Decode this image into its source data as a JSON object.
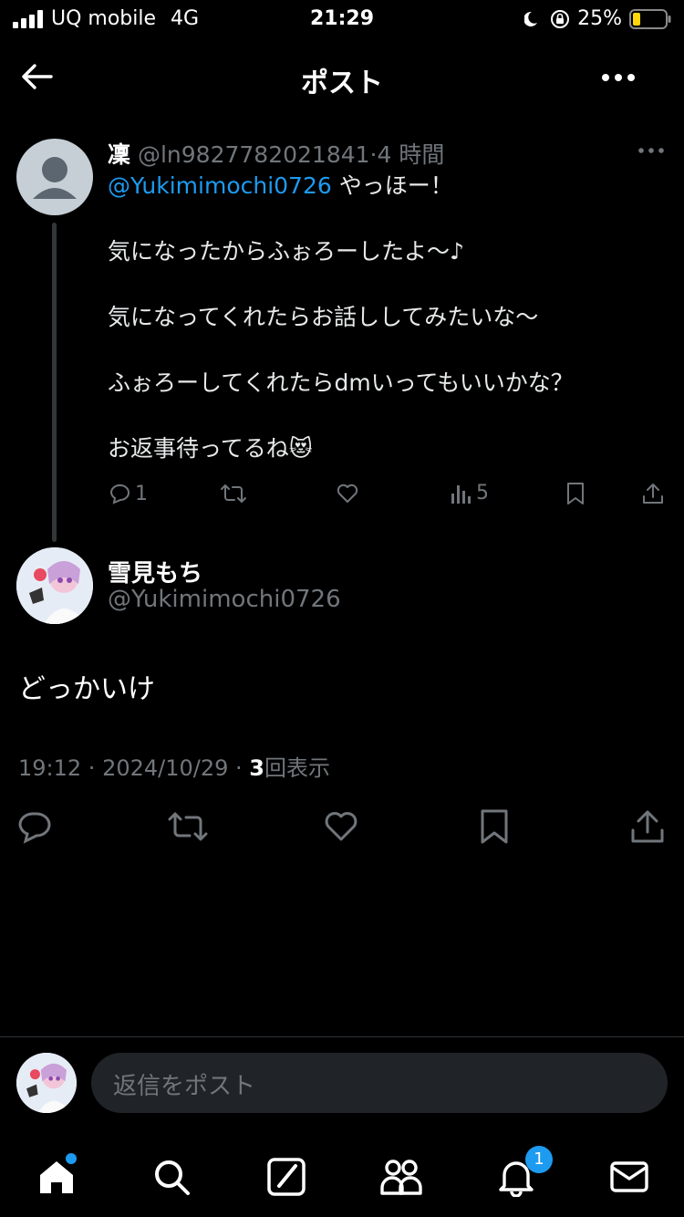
{
  "status_bar": {
    "carrier": "UQ mobile",
    "network": "4G",
    "time": "21:29",
    "battery": "25%"
  },
  "header": {
    "title": "ポスト"
  },
  "tweet1": {
    "name": "凜",
    "handle": "@ln9827782021841",
    "time": "4 時間",
    "mention": "@Yukimimochi0726",
    "lines": [
      "やっほー！",
      "気になったからふぉろーしたよ〜♪",
      "気になってくれたらお話ししてみたいな〜",
      "ふぉろーしてくれたらdmいってもいいかな？",
      "お返事待ってるね😻"
    ],
    "reply_count": "1",
    "view_count": "5"
  },
  "tweet2": {
    "name": "雪見もち",
    "handle": "@Yukimimochi0726",
    "body": "どっかいけ",
    "time": "19:12",
    "date": "2024/10/29",
    "views": "3",
    "views_suffix": "回表示"
  },
  "reply": {
    "placeholder": "返信をポスト"
  },
  "tabbar": {
    "notifications_badge": "1"
  },
  "colors": {
    "accent": "#1d9bf0",
    "muted": "#71767b",
    "background": "#000000"
  }
}
